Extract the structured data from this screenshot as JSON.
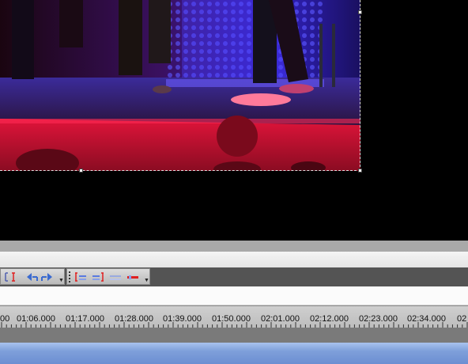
{
  "preview": {
    "content": "concert stage video frame"
  },
  "toolbar": {
    "group1_buttons": [
      "trim-in-icon",
      "step-back-icon",
      "step-forward-icon"
    ],
    "group2_buttons": [
      "mark-in-icon",
      "mark-out-icon",
      "clear-marks-icon",
      "red-marker-icon"
    ]
  },
  "timeline": {
    "ruler_labels": [
      "00",
      "01:06.000",
      "01:17.000",
      "01:28.000",
      "01:39.000",
      "01:50.000",
      "02:01.000",
      "02:12.000",
      "02:23.000",
      "02:34.000",
      "02"
    ]
  },
  "colors": {
    "stage_red": "#c8102e",
    "stage_blue": "#3a2bd6",
    "track_blue": "#7e9fda",
    "toolbar_dark": "#545454"
  }
}
